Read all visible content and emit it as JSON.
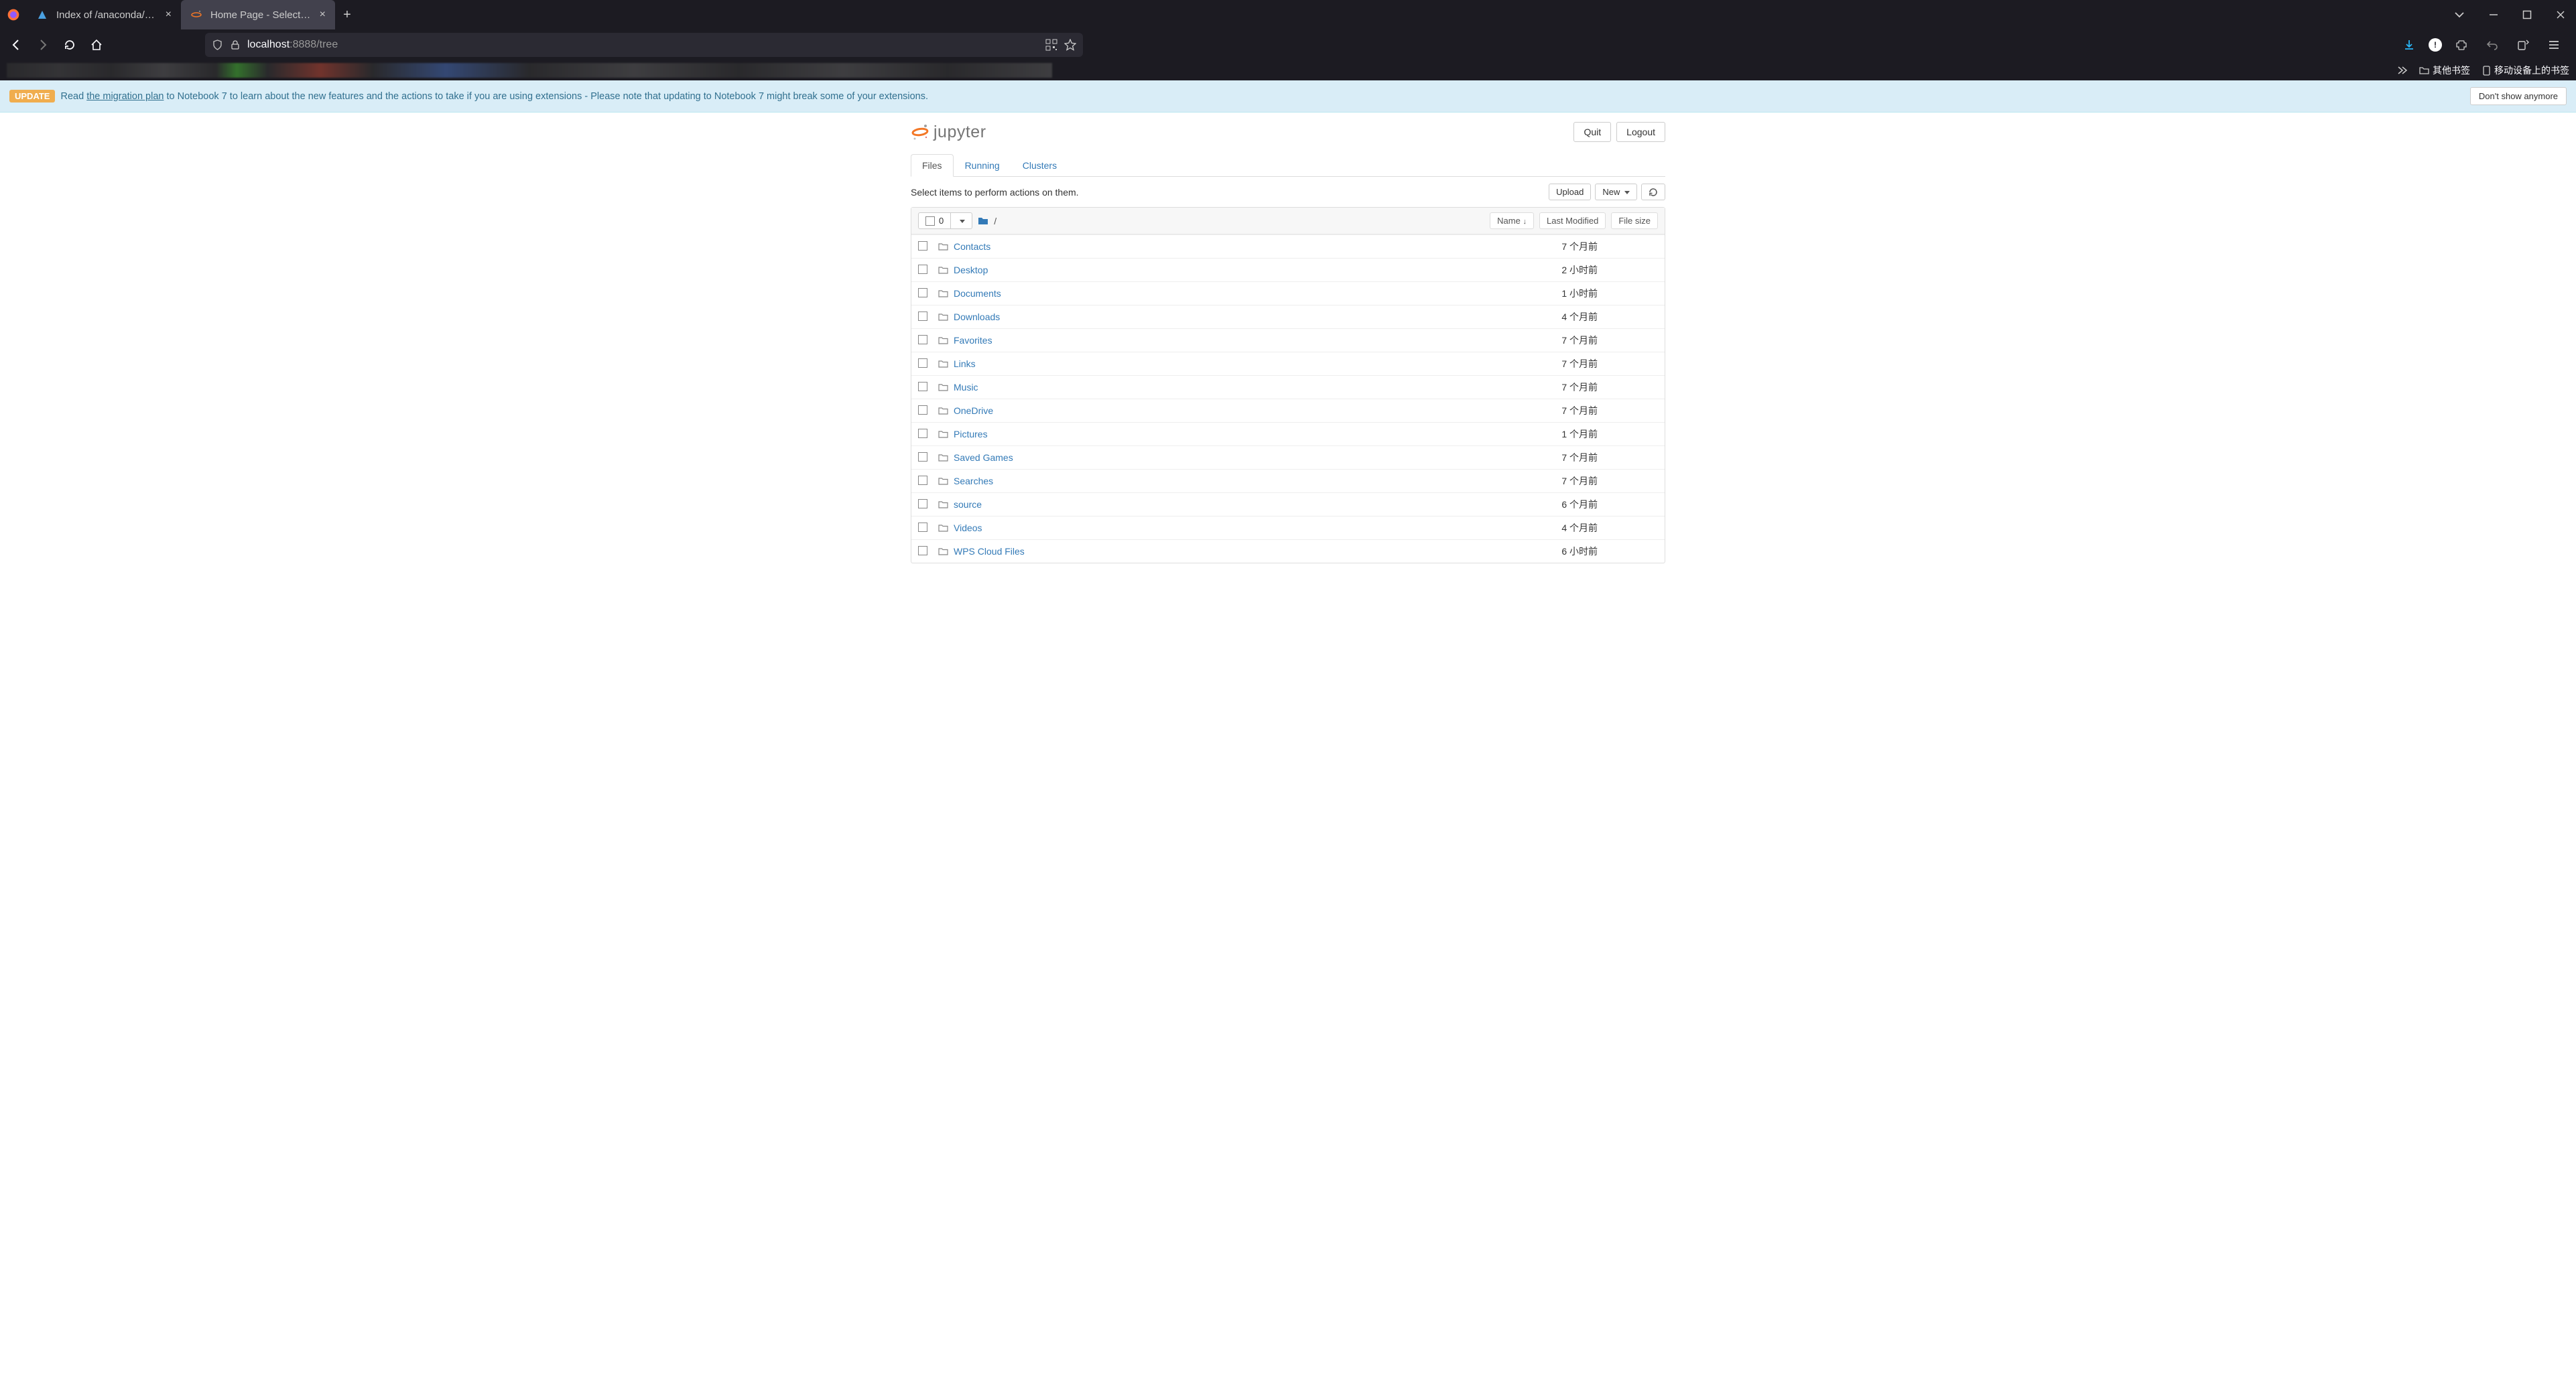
{
  "browser": {
    "tabs": [
      {
        "title": "Index of /anaconda/archive/"
      },
      {
        "title": "Home Page - Select or create"
      }
    ],
    "url_host": "localhost",
    "url_port": ":8888",
    "url_path": "/tree",
    "bookmarks_other": "其他书签",
    "bookmarks_mobile": "移动设备上的书签"
  },
  "banner": {
    "badge": "UPDATE",
    "text_before": "Read ",
    "link": "the migration plan",
    "text_after": " to Notebook 7 to learn about the new features and the actions to take if you are using extensions - Please note that updating to Notebook 7 might break some of your extensions.",
    "dismiss": "Don't show anymore"
  },
  "header": {
    "logo_text": "jupyter",
    "quit": "Quit",
    "logout": "Logout"
  },
  "tabs": {
    "files": "Files",
    "running": "Running",
    "clusters": "Clusters"
  },
  "toolbar": {
    "hint": "Select items to perform actions on them.",
    "upload": "Upload",
    "new": "New",
    "select_count": "0",
    "breadcrumb_root": "/"
  },
  "columns": {
    "name": "Name",
    "modified": "Last Modified",
    "size": "File size"
  },
  "files": [
    {
      "name": "Contacts",
      "modified": "7 个月前"
    },
    {
      "name": "Desktop",
      "modified": "2 小时前"
    },
    {
      "name": "Documents",
      "modified": "1 小时前"
    },
    {
      "name": "Downloads",
      "modified": "4 个月前"
    },
    {
      "name": "Favorites",
      "modified": "7 个月前"
    },
    {
      "name": "Links",
      "modified": "7 个月前"
    },
    {
      "name": "Music",
      "modified": "7 个月前"
    },
    {
      "name": "OneDrive",
      "modified": "7 个月前"
    },
    {
      "name": "Pictures",
      "modified": "1 个月前"
    },
    {
      "name": "Saved Games",
      "modified": "7 个月前"
    },
    {
      "name": "Searches",
      "modified": "7 个月前"
    },
    {
      "name": "source",
      "modified": "6 个月前"
    },
    {
      "name": "Videos",
      "modified": "4 个月前"
    },
    {
      "name": "WPS Cloud Files",
      "modified": "6 小时前"
    }
  ]
}
